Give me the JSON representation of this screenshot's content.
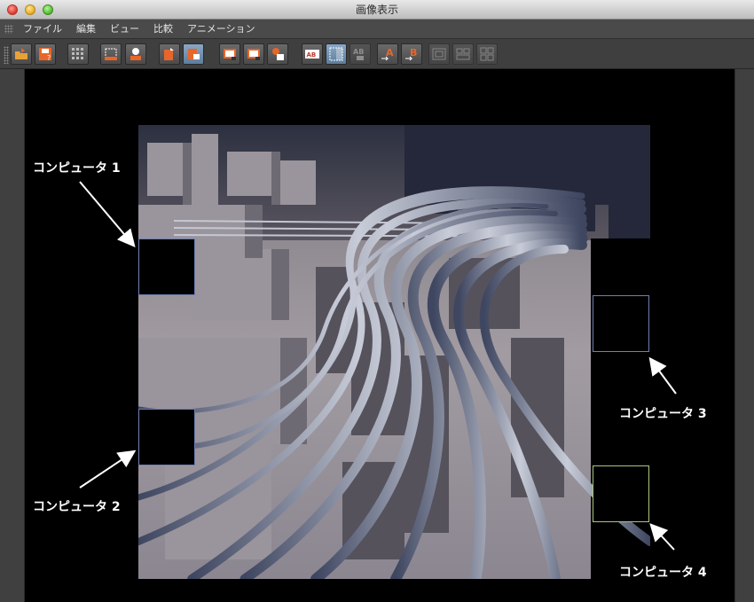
{
  "window": {
    "title": "画像表示"
  },
  "menu": {
    "items": [
      "ファイル",
      "編集",
      "ビュー",
      "比較",
      "アニメーション"
    ]
  },
  "toolbar": {
    "buttons": [
      {
        "icon": "open-folder-icon"
      },
      {
        "icon": "save-icon"
      },
      {
        "icon": "grid-icon"
      },
      {
        "icon": "region-select-icon"
      },
      {
        "icon": "person-icon"
      },
      {
        "icon": "channel-orange-icon"
      },
      {
        "icon": "channel-blue-icon"
      },
      {
        "icon": "frame-view-1-icon"
      },
      {
        "icon": "frame-view-2-icon"
      },
      {
        "icon": "frame-view-3-icon"
      },
      {
        "icon": "compare-ab-icon"
      },
      {
        "icon": "compare-split-icon"
      },
      {
        "icon": "compare-ab-dim-icon"
      },
      {
        "icon": "set-a-icon"
      },
      {
        "icon": "set-b-icon"
      },
      {
        "icon": "layout-1-icon"
      },
      {
        "icon": "layout-2-icon"
      },
      {
        "icon": "layout-3-icon"
      }
    ]
  },
  "annotations": {
    "computer1": "コンピュータ 1",
    "computer2": "コンピュータ 2",
    "computer3": "コンピュータ 3",
    "computer4": "コンピュータ 4"
  },
  "colors": {
    "tile_border_blue": "#6f7fb3",
    "tile_border_green": "#a9c77a",
    "icon_orange": "#e8662a",
    "icon_blue": "#5d7d9c"
  }
}
